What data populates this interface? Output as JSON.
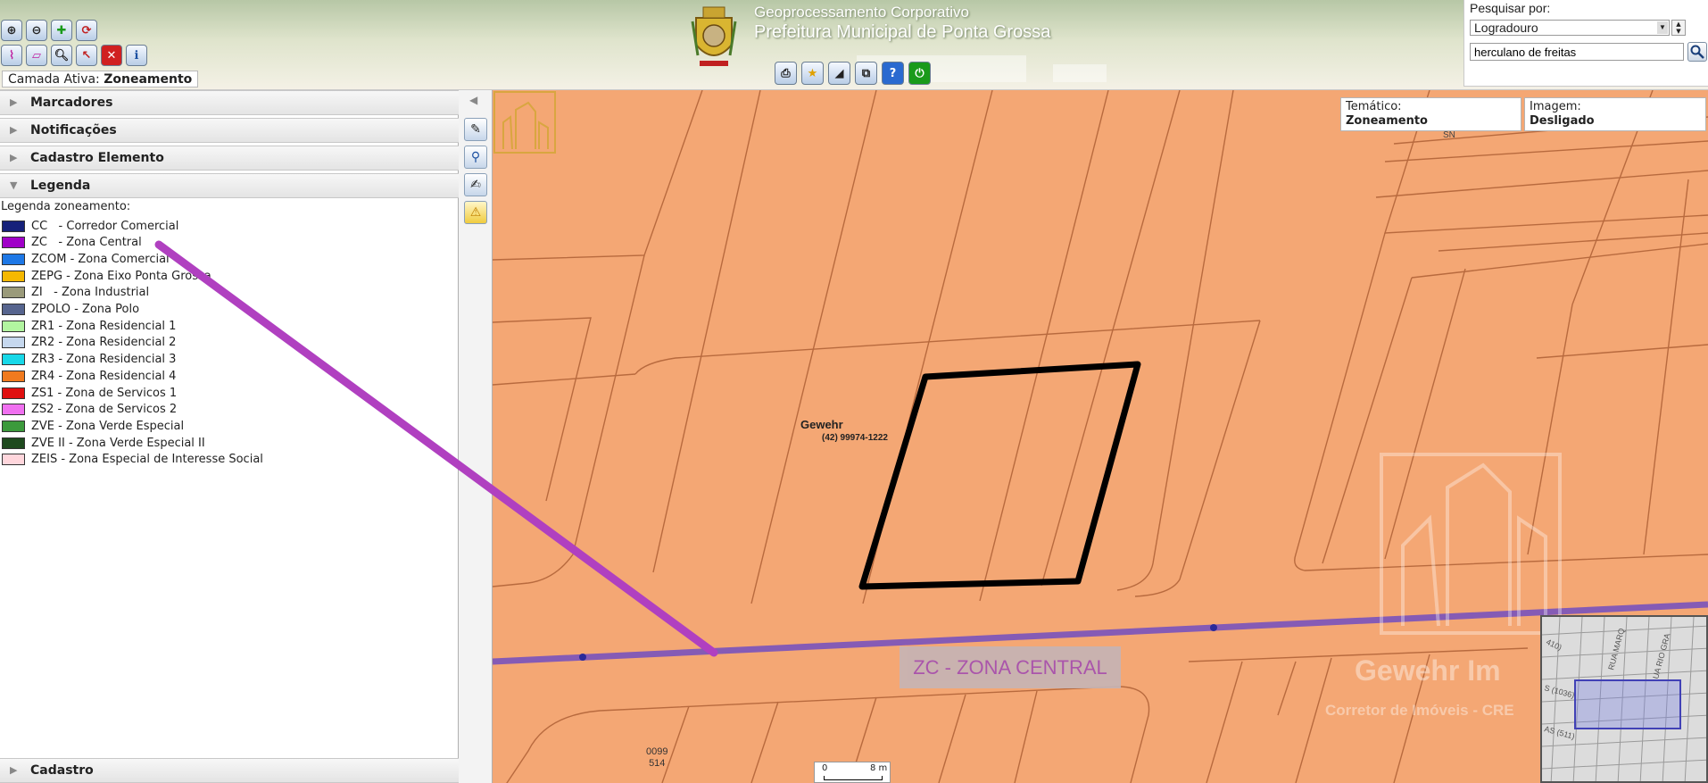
{
  "header": {
    "title": "Geoprocessamento Corporativo",
    "subtitle": "Prefeitura Municipal de Ponta Grossa",
    "active_layer_label": "Camada Ativa:",
    "active_layer_value": "Zoneamento"
  },
  "toolbar": {
    "row1_icons": [
      "zoom-in-icon",
      "zoom-out-icon",
      "pan-plus-icon",
      "refresh-map-icon"
    ],
    "row2_icons": [
      "measure-distance-icon",
      "measure-area-icon",
      "zoom-box-icon",
      "select-point-icon",
      "clear-icon",
      "info-icon"
    ],
    "center_icons": [
      "print-icon",
      "favorite-icon",
      "triangle-tool-icon",
      "layers-tool-icon",
      "help-icon",
      "power-icon"
    ]
  },
  "search": {
    "label": "Pesquisar por:",
    "type_value": "Logradouro",
    "query_value": "herculano de freitas"
  },
  "panel": {
    "sections": {
      "marcadores": "Marcadores",
      "notificacoes": "Notificações",
      "cadastro_elemento": "Cadastro Elemento",
      "legenda": "Legenda",
      "cadastro": "Cadastro"
    },
    "legend_title": "Legenda zoneamento:",
    "legend": [
      {
        "label": "CC   - Corredor Comercial",
        "color": "#16217a"
      },
      {
        "label": "ZC   - Zona Central",
        "color": "#a000c8"
      },
      {
        "label": "ZCOM - Zona Comercial",
        "color": "#1e78e6"
      },
      {
        "label": "ZEPG - Zona Eixo Ponta Grossa",
        "color": "#f5b800"
      },
      {
        "label": "ZI   - Zona Industrial",
        "color": "#9a9a7a"
      },
      {
        "label": "ZPOLO - Zona Polo",
        "color": "#56648e"
      },
      {
        "label": "ZR1 - Zona Residencial 1",
        "color": "#b2f5a0"
      },
      {
        "label": "ZR2 - Zona Residencial 2",
        "color": "#c6d8ee"
      },
      {
        "label": "ZR3 - Zona Residencial 3",
        "color": "#18d8e8"
      },
      {
        "label": "ZR4 - Zona Residencial 4",
        "color": "#f07a1e"
      },
      {
        "label": "ZS1 - Zona de Servicos 1",
        "color": "#e01010"
      },
      {
        "label": "ZS2 - Zona de Servicos 2",
        "color": "#f070f0"
      },
      {
        "label": "ZVE - Zona Verde Especial",
        "color": "#3c9a3c"
      },
      {
        "label": "ZVE II - Zona Verde Especial II",
        "color": "#1e4a1e"
      },
      {
        "label": "ZEIS - Zona Especial de Interesse Social",
        "color": "#ffd6dc"
      }
    ]
  },
  "map": {
    "tematico_label": "Temático:",
    "tematico_value": "Zoneamento",
    "imagem_label": "Imagem:",
    "imagem_value": "Desligado",
    "zone_label": "ZC - ZONA CENTRAL",
    "street_code": "SN",
    "lot_number_1": "0099",
    "lot_number_2": "514",
    "scale_min": "0",
    "scale_max": "8 m",
    "zone_fill_color": "#f4a774",
    "zc_line_color": "#7e56b8",
    "pointer_color": "#b040c0"
  },
  "watermark": {
    "brand": "Gewehr",
    "phone": "(42) 99974-1222",
    "brand_large": "Gewehr Im",
    "tagline": "Corretor de Imóveis - CRE"
  },
  "minimap": {
    "street_1": "RUA MARQ",
    "street_2": "UA RIO GRA",
    "street_3": "410)",
    "street_4": "S (1036)",
    "street_5": "AS (511)"
  }
}
